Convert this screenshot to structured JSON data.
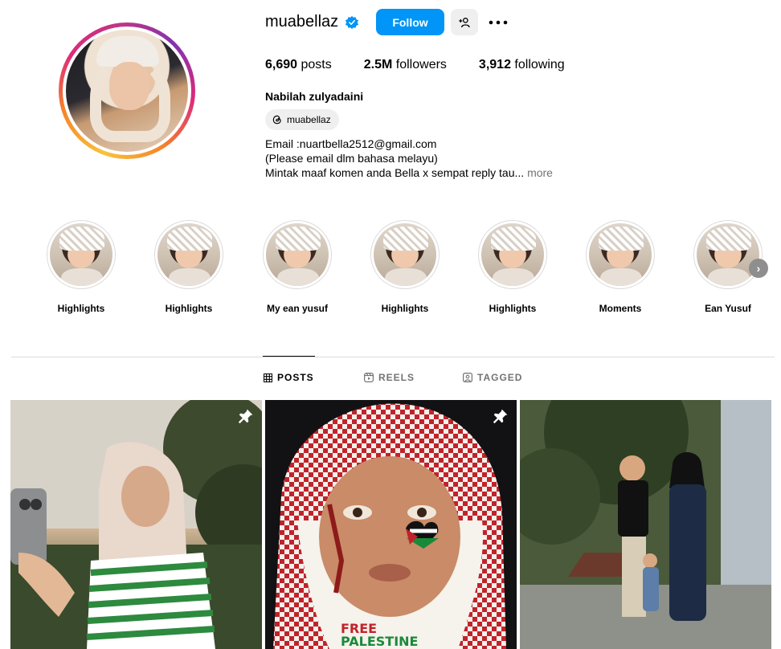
{
  "profile": {
    "username": "muabellaz",
    "verified": true,
    "follow_label": "Follow",
    "posts_count": "6,690",
    "posts_label": "posts",
    "followers_count": "2.5M",
    "followers_label": "followers",
    "following_count": "3,912",
    "following_label": "following",
    "full_name": "Nabilah zulyadaini",
    "threads_handle": "muabellaz",
    "bio_lines": [
      "Email :nuartbella2512@gmail.com",
      "(Please email dlm bahasa melayu)",
      "Mintak maaf komen anda Bella x sempat reply tau..."
    ],
    "bio_more": "more"
  },
  "highlights": [
    {
      "label": "Highlights"
    },
    {
      "label": "Highlights"
    },
    {
      "label": "My ean yusuf"
    },
    {
      "label": "Highlights"
    },
    {
      "label": "Highlights"
    },
    {
      "label": "Moments"
    },
    {
      "label": "Ean Yusuf"
    }
  ],
  "tabs": [
    {
      "label": "POSTS",
      "icon": "grid-icon",
      "active": true
    },
    {
      "label": "REELS",
      "icon": "reels-icon",
      "active": false
    },
    {
      "label": "TAGGED",
      "icon": "tagged-icon",
      "active": false
    }
  ],
  "posts": [
    {
      "pinned": true
    },
    {
      "pinned": true,
      "overlay_text_1": "FREE",
      "overlay_text_2": "PALESTINE"
    },
    {
      "pinned": false
    }
  ],
  "colors": {
    "accent": "#0095f6",
    "verified": "#0095f6",
    "muted_text": "#737373",
    "divider": "#dbdbdb"
  }
}
